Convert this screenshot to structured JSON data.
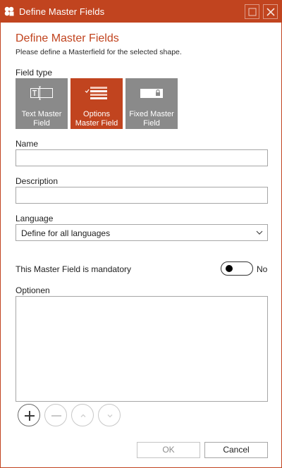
{
  "window": {
    "title": "Define Master Fields",
    "accent_color": "#c1441f",
    "controls": [
      "maximize-icon",
      "close-icon"
    ]
  },
  "header": {
    "title": "Define Master Fields",
    "subtitle": "Please define a Masterfield for the selected shape."
  },
  "field_type": {
    "label": "Field type",
    "tiles": [
      {
        "label": "Text Master Field",
        "icon": "text-field-icon",
        "selected": false
      },
      {
        "label": "Options Master Field",
        "icon": "options-list-icon",
        "selected": true
      },
      {
        "label": "Fixed Master Field",
        "icon": "locked-field-icon",
        "selected": false
      }
    ]
  },
  "name": {
    "label": "Name",
    "value": ""
  },
  "description": {
    "label": "Description",
    "value": ""
  },
  "language": {
    "label": "Language",
    "selected": "Define for all languages"
  },
  "mandatory": {
    "label": "This Master Field is mandatory",
    "state": "No",
    "on": false
  },
  "options": {
    "label": "Optionen",
    "items": [],
    "buttons": [
      "add-icon",
      "remove-icon",
      "move-up-icon",
      "move-down-icon"
    ]
  },
  "footer": {
    "ok_label": "OK",
    "cancel_label": "Cancel"
  }
}
